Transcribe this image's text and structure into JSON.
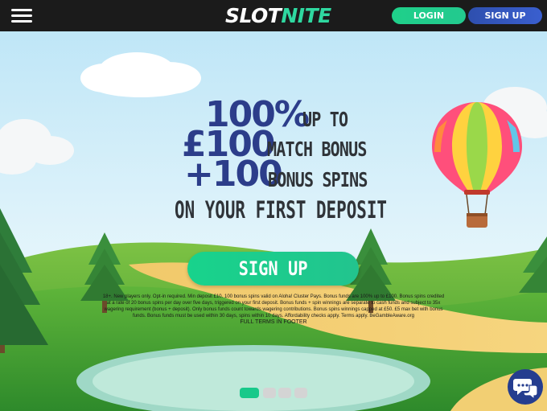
{
  "header": {
    "menu_icon": "hamburger-menu-icon",
    "logo_part1": "SLOT",
    "logo_part2": "NITE",
    "login_label": "LOGIN",
    "signup_label": "SIGN UP"
  },
  "promo": {
    "line1_big": "100%",
    "line1_small": "UP TO",
    "line2_big": "£100",
    "line2_small": "MATCH BONUS",
    "line3_big": "+100",
    "line3_small": "BONUS SPINS",
    "line4": "ON YOUR FIRST DEPOSIT",
    "cta_label": "SIGN UP",
    "terms": "18+. New players only. Opt-in required. Min deposit £10. 100 bonus spins valid on Aloha! Cluster Pays. Bonus funds are 100% up to £100. Bonus spins credited at a rate of 20 bonus spins per day over five days, triggered on your first deposit. Bonus funds + spin winnings are separate to cash funds and subject to 35x wagering requirement (bonus + deposit). Only bonus funds count towards wagering contributions. Bonus spins winnings capped at £50. £5 max bet with bonus funds. Bonus funds must be used within 30 days, spins within 10 days. Affordability checks apply. Terms apply. BeGambleAware.org",
    "terms_footer": "FULL TERMS IN FOOTER"
  },
  "carousel": {
    "count": 4,
    "active_index": 0
  },
  "chat": {
    "icon": "chat-bubbles-icon"
  },
  "colors": {
    "header_bg": "#1b1b1b",
    "accent_green": "#18d38c",
    "accent_blue": "#2e4fae",
    "headline_blue": "#2c3d8a"
  }
}
